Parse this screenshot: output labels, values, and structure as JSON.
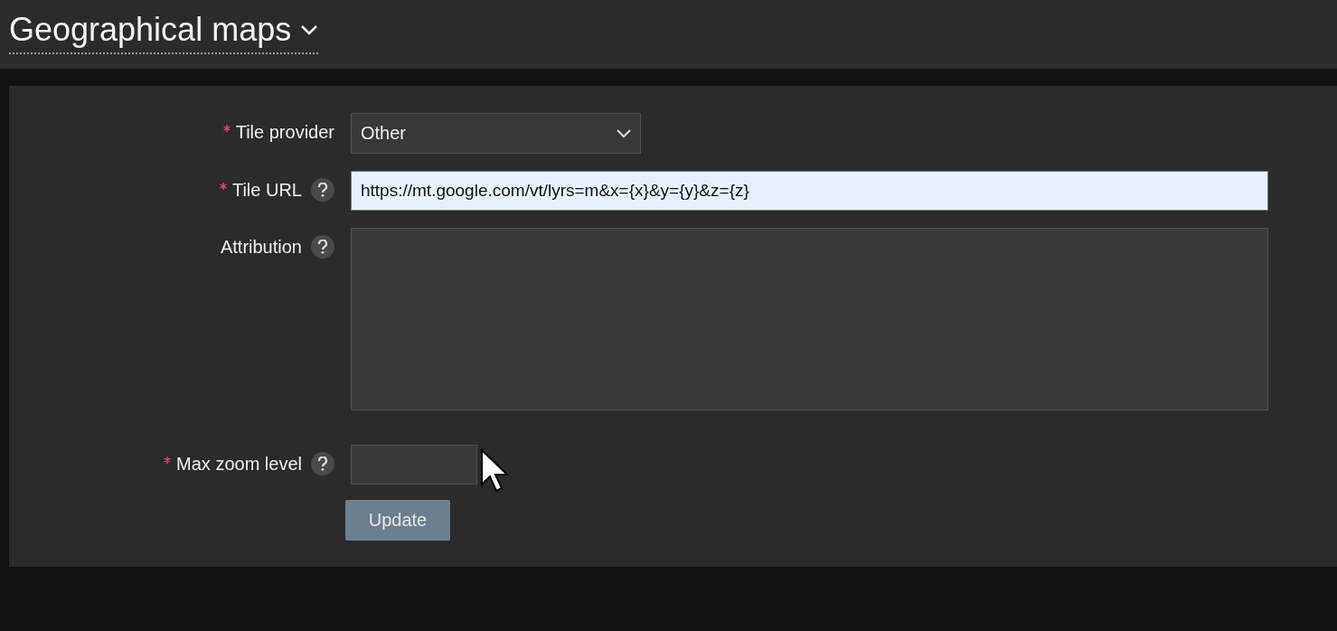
{
  "header": {
    "title": "Geographical maps"
  },
  "form": {
    "fields": [
      {
        "kind": "select",
        "label": "Tile provider",
        "required": true,
        "help": false,
        "value": "Other"
      },
      {
        "kind": "text",
        "label": "Tile URL",
        "required": true,
        "help": true,
        "value": "https://mt.google.com/vt/lyrs=m&x={x}&y={y}&z={z}"
      },
      {
        "kind": "textarea",
        "label": "Attribution",
        "required": false,
        "help": true
      },
      {
        "kind": "number",
        "label": "Max zoom level",
        "required": true,
        "help": true
      }
    ],
    "button": {
      "label": "Update",
      "disabled": true
    }
  }
}
